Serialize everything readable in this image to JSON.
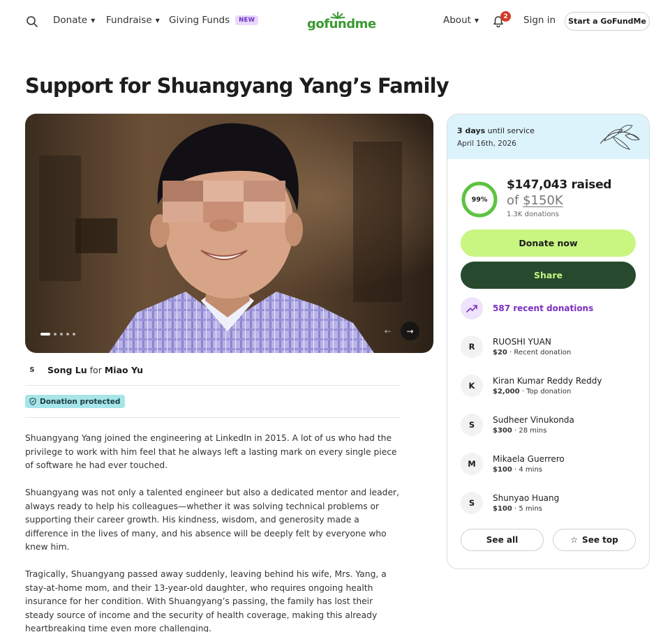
{
  "header": {
    "donate": "Donate",
    "fundraise": "Fundraise",
    "giving_funds": "Giving Funds",
    "new_badge": "NEW",
    "logo": "gofundme",
    "about": "About",
    "notification_count": "2",
    "sign_in": "Sign in",
    "start_button": "Start a GoFundMe",
    "logo_color": "#3a9a32"
  },
  "campaign": {
    "title": "Support for Shuangyang Yang’s Family",
    "organizer_initial": "S",
    "organizer": "Song Lu",
    "for_text": "for",
    "beneficiary": "Miao Yu",
    "protected_label": "Donation protected",
    "carousel": {
      "slides": 5,
      "active": 1
    }
  },
  "story": {
    "paragraphs": [
      "Shuangyang Yang joined the engineering at LinkedIn in 2015. A lot of us who had the privilege to work with him feel that he always left a lasting mark on every single piece of software he had ever touched.",
      "Shuangyang was not only a talented engineer but also a dedicated mentor and leader, always ready to help his colleagues—whether it was solving technical problems or supporting their career growth. His kindness, wisdom, and generosity made a difference in the lives of many, and his absence will be deeply felt by everyone who knew him.",
      "Tragically, Shuangyang passed away suddenly, leaving behind his wife, Mrs. Yang, a stay-at-home mom, and their 13-year-old daughter, who requires ongoing health insurance for her condition. With Shuangyang’s passing, the family has lost their steady source of income and the security of health coverage, making this already heartbreaking time even more challenging."
    ]
  },
  "sidebar": {
    "days": "3 days",
    "days_suffix": "until service",
    "service_date": "April 16th, 2026",
    "progress_percent": 99,
    "progress_label": "99%",
    "raised": "$147,043 raised",
    "goal_prefix": "of",
    "goal": "$150K",
    "donation_count": "1.3K donations",
    "donate_button": "Donate now",
    "share_button": "Share",
    "recent_donations": "587 recent donations",
    "donors": [
      {
        "initial": "R",
        "name": "RUOSHI YUAN",
        "amount": "$20",
        "note": "· Recent donation"
      },
      {
        "initial": "K",
        "name": "Kiran Kumar Reddy Reddy",
        "amount": "$2,000",
        "note": "· Top donation"
      },
      {
        "initial": "S",
        "name": "Sudheer Vinukonda",
        "amount": "$300",
        "note": "· 28 mins"
      },
      {
        "initial": "M",
        "name": "Mikaela Guerrero",
        "amount": "$100",
        "note": "· 4 mins"
      },
      {
        "initial": "S",
        "name": "Shunyao Huang",
        "amount": "$100",
        "note": "· 5 mins"
      }
    ],
    "see_all": "See all",
    "see_top": "See top",
    "colors": {
      "donate": "#c9f581",
      "share": "#274a2f",
      "accent_purple": "#7b2fbf",
      "progress": "#5cc341",
      "memorial_bg": "#dcf3fb"
    }
  }
}
